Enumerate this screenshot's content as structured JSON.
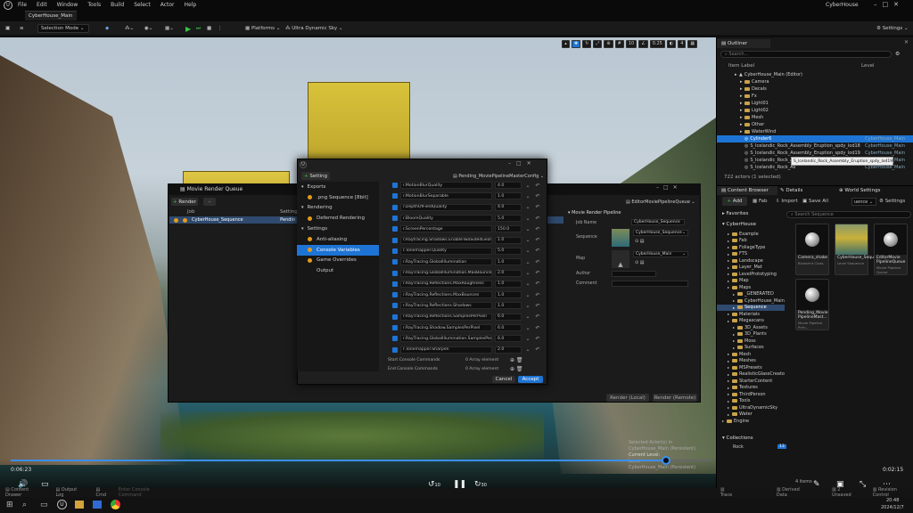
{
  "menubar": {
    "logo": "U",
    "items": [
      "File",
      "Edit",
      "Window",
      "Tools",
      "Build",
      "Select",
      "Actor",
      "Help"
    ],
    "project": "CyberHouse"
  },
  "tab": {
    "label": "CyberHouse_Main"
  },
  "toolbar": {
    "selection_mode": "Selection Mode",
    "platforms": "Platforms",
    "sky": "Ultra Dynamic Sky",
    "settings": "Settings"
  },
  "viewport": {
    "chips": [
      "10",
      "0.25",
      "4"
    ]
  },
  "outliner": {
    "tab": "Outliner",
    "search_placeholder": "Search...",
    "col_label": "Item Label",
    "col_level": "Level",
    "rows": [
      {
        "label": "CyberHouse_Main (Editor)",
        "indent": 1,
        "folder": false,
        "level": ""
      },
      {
        "label": "Camera",
        "indent": 2,
        "folder": true,
        "level": ""
      },
      {
        "label": "Decals",
        "indent": 2,
        "folder": true,
        "level": ""
      },
      {
        "label": "Fx",
        "indent": 2,
        "folder": true,
        "level": ""
      },
      {
        "label": "Light01",
        "indent": 2,
        "folder": true,
        "level": ""
      },
      {
        "label": "Light02",
        "indent": 2,
        "folder": true,
        "level": ""
      },
      {
        "label": "Mesh",
        "indent": 2,
        "folder": true,
        "level": ""
      },
      {
        "label": "Other",
        "indent": 2,
        "folder": true,
        "level": ""
      },
      {
        "label": "WaterWind",
        "indent": 2,
        "folder": true,
        "level": ""
      },
      {
        "label": "Cylinder6",
        "indent": 2,
        "folder": false,
        "level": "CyberHouse_Main",
        "sel": true
      },
      {
        "label": "S_Icelandic_Rock_Assembly_Eruption_spdy_lod18",
        "indent": 2,
        "folder": false,
        "level": "CyberHouse_Main"
      },
      {
        "label": "S_Icelandic_Rock_Assembly_Eruption_spdy_lod19",
        "indent": 2,
        "folder": false,
        "level": "CyberHouse_Main"
      },
      {
        "label": "S_Icelandic_Rock_As",
        "indent": 2,
        "folder": false,
        "level": "CyberHouse_Main"
      },
      {
        "label": "S_Icelandic_Rock_As",
        "indent": 2,
        "folder": false,
        "level": "CyberHouse_Main"
      }
    ],
    "tooltip": "S_Icelandic_Rock_Assembly_Eruption_spdy_lod19",
    "count": "722 actors (1 selected)"
  },
  "content_browser": {
    "tabs": [
      "Content Browser",
      "Details",
      "World Settings"
    ],
    "add": "Add",
    "fab": "Fab",
    "import": "Import",
    "save_all": "Save All",
    "path_box": "uence",
    "settings": "Settings",
    "favorites": "Favorites",
    "root": "CyberHouse",
    "search_placeholder": "Search Sequence",
    "tree": [
      {
        "label": "Example",
        "indent": 2
      },
      {
        "label": "Fab",
        "indent": 2
      },
      {
        "label": "FoliageType",
        "indent": 2
      },
      {
        "label": "FTS",
        "indent": 2
      },
      {
        "label": "Landscape",
        "indent": 2
      },
      {
        "label": "Layer_Mat",
        "indent": 2
      },
      {
        "label": "LevelPrototyping",
        "indent": 2
      },
      {
        "label": "Map",
        "indent": 2
      },
      {
        "label": "Maps",
        "indent": 2
      },
      {
        "label": "_GENERATED",
        "indent": 3
      },
      {
        "label": "CyberHouse_Main",
        "indent": 3
      },
      {
        "label": "Sequence",
        "indent": 3,
        "sel": true
      },
      {
        "label": "Materials",
        "indent": 2
      },
      {
        "label": "Megascans",
        "indent": 2
      },
      {
        "label": "3D_Assets",
        "indent": 3
      },
      {
        "label": "3D_Plants",
        "indent": 3
      },
      {
        "label": "Moss",
        "indent": 3
      },
      {
        "label": "Surfaces",
        "indent": 3
      },
      {
        "label": "Mesh",
        "indent": 2
      },
      {
        "label": "Meshes",
        "indent": 2
      },
      {
        "label": "MSPresets",
        "indent": 2
      },
      {
        "label": "RealisticGlassCreato",
        "indent": 2
      },
      {
        "label": "StarterContent",
        "indent": 2
      },
      {
        "label": "Textures",
        "indent": 2
      },
      {
        "label": "ThirdPerson",
        "indent": 2
      },
      {
        "label": "Tools",
        "indent": 2
      },
      {
        "label": "UltraDynamicSky",
        "indent": 2
      },
      {
        "label": "Water",
        "indent": 2
      },
      {
        "label": "Engine",
        "indent": 1
      }
    ],
    "assets": [
      {
        "name": "Camera_shake",
        "type": "Blueprint Class",
        "thumb": "ball"
      },
      {
        "name": "CyberHouse_Sequence",
        "type": "Level Sequence",
        "thumb": "image"
      },
      {
        "name": "EditorMovie PipelineQueue",
        "type": "Movie Pipeline Queue",
        "thumb": "ball"
      },
      {
        "name": "Pending_Movie PipelineMast...",
        "type": "Movie Pipeline Prim...",
        "thumb": "ball"
      }
    ],
    "collections": "Collections",
    "collection_rows": [
      {
        "label": "Rock",
        "count": "13"
      }
    ],
    "items_count": "4 items"
  },
  "mrq": {
    "title": "Movie Render Queue",
    "render_btn": "Render",
    "col_job": "Job",
    "col_settings": "Setting",
    "job_name": "CyberHouse_Sequence",
    "job_setting": "Pendin",
    "queue_name": "EditorMoviePipelineQueue",
    "section": "Movie Render Pipeline",
    "job_name_label": "Job Name",
    "job_name_value": "CyberHouse_Sequence",
    "sequence_label": "Sequence",
    "sequence_value": "CyberHouse_Sequence",
    "map_label": "Map",
    "map_value": "CyberHouse_Main",
    "author_label": "Author",
    "comment_label": "Comment",
    "render_local": "Render (Local)",
    "render_remote": "Render (Remote)"
  },
  "cfg": {
    "icon": "U",
    "setting_btn": "Setting",
    "preset": "Pending_MoviePipelineMasterConfig",
    "groups": [
      {
        "label": "Exports",
        "indent": 0,
        "dot": false
      },
      {
        "label": ".png Sequence [8bit]",
        "indent": 1,
        "dot": true
      },
      {
        "label": "Rendering",
        "indent": 0,
        "dot": false
      },
      {
        "label": "Deferred Rendering",
        "indent": 1,
        "dot": true
      },
      {
        "label": "Settings",
        "indent": 0,
        "dot": false
      },
      {
        "label": "Anti-aliasing",
        "indent": 1,
        "dot": true
      },
      {
        "label": "Console Variables",
        "indent": 1,
        "dot": true,
        "sel": true
      },
      {
        "label": "Game Overrides",
        "indent": 1,
        "dot": true
      },
      {
        "label": "Output",
        "indent": 1,
        "dot": false
      }
    ],
    "cvars": [
      {
        "name": "r.MotionBlurQuality",
        "value": "4.0"
      },
      {
        "name": "r.MotionBlurSeparable",
        "value": "1.0"
      },
      {
        "name": "r.DepthOfFieldQuality",
        "value": "4.0"
      },
      {
        "name": "r.BloomQuality",
        "value": "5.0"
      },
      {
        "name": "r.ScreenPercentage",
        "value": "150.0"
      },
      {
        "name": "r.Raytracing.Shadows.EnableTwoSidedGeom",
        "value": "1.0"
      },
      {
        "name": "r.Tonemapper.Quality",
        "value": "5.0"
      },
      {
        "name": "r.RayTracing.GlobalIllumination",
        "value": "1.0"
      },
      {
        "name": "r.RayTracing.GlobalIllumination.MaxBounces",
        "value": "2.0"
      },
      {
        "name": "r.RayTracing.Reflections.MaxRoughness",
        "value": "1.0"
      },
      {
        "name": "r.RayTracing.Reflections.MaxBounces",
        "value": "1.0"
      },
      {
        "name": "r.RayTracing.Reflections.Shadows",
        "value": "1.0"
      },
      {
        "name": "r.RayTracing.Reflections.SamplesPerPixel",
        "value": "6.0"
      },
      {
        "name": "r.RayTracing.Shadow.SamplesPerPixel",
        "value": "6.0"
      },
      {
        "name": "r.RayTracing.GlobalIllumination.SamplesPerP",
        "value": "6.0"
      },
      {
        "name": "r.Tonemapper.Sharpen",
        "value": "2.0"
      }
    ],
    "start_label": "Start Console Commands",
    "start_value": "0 Array element",
    "end_label": "End Console Commands",
    "end_value": "0 Array element",
    "cancel": "Cancel",
    "accept": "Accept"
  },
  "timeline": {
    "current": "0:06:23",
    "total": "0:02:15",
    "progress": 0.935,
    "rewind": "10",
    "forward": "30"
  },
  "overlay": {
    "line1": "Selected Actor(s) in",
    "line2": "CyberHouse_Main (Persistent)",
    "line3": "Current Level:",
    "line4": "Level",
    "line5": "CyberHouse_Main (Persistent)"
  },
  "statusbar": {
    "content_drawer": "Content Drawer",
    "output_log": "Output Log",
    "cmd": "Cmd",
    "cmd_placeholder": "Enter Console Command",
    "trace": "Trace",
    "derived": "Derived Data",
    "unsaved": "2 Unsaved",
    "revision": "Revision Control"
  },
  "taskbar": {
    "time": "20:48",
    "date": "2024/12/7"
  },
  "colors": {
    "accent": "#1e74d4",
    "folder": "#c9a24a",
    "play": "#36c44a",
    "dot": "#e39b1a"
  }
}
